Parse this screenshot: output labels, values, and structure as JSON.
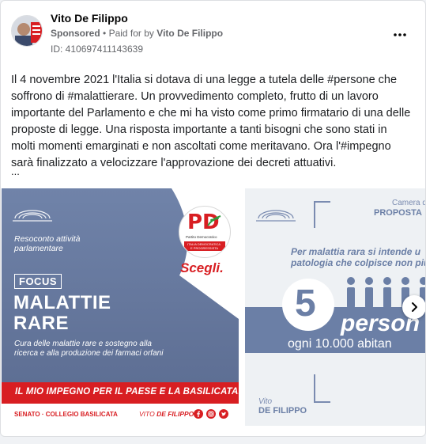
{
  "post": {
    "author": "Vito De Filippo",
    "sponsored": "Sponsored",
    "separator": "•",
    "paid_for_by": "Paid for by",
    "payer": "Vito De Filippo",
    "ad_id": "ID: 410697411143639",
    "body": "Il 4 novembre 2021 l'Italia si dotava di una legge a tutela delle #persone che soffrono di #malattierare. Un provvedimento completo, frutto di un lavoro importante del Parlamento e che mi ha visto come primo firmatario di una delle proposte di legge. Una risposta importante a tanti bisogni che sono stati in molti momenti emarginati e non ascoltati come meritavano. Ora l'#impegno sarà finalizzato a velocizzare l'approvazione dei decreti attuativi.",
    "ellipsis": "..."
  },
  "slide1": {
    "resoconto_line1": "Resoconto attività",
    "resoconto_line2": "parlamentare",
    "focus": "FOCUS",
    "title_line1": "MALATTIE",
    "title_line2": "RARE",
    "desc_line1": "Cura delle malattie rare e sostegno alla",
    "desc_line2": "ricerca e alla produzione dei farmaci orfani",
    "party_logo_text": "PD",
    "party_name": "Partito Democratico",
    "party_list_line1": "ITALIA DEMOCRATICA",
    "party_list_line2": "E PROGRESSISTA",
    "scegli": "Scegli.",
    "banner": "IL MIO IMPEGNO PER IL PAESE E LA BASILICATA.",
    "footer_left": "SENATO · COLLEGIO BASILICATA",
    "footer_name_first": "VITO",
    "footer_name_last": "DE FILIPPO",
    "colors": {
      "blue": "#6b7fa6",
      "red": "#d81e22",
      "green": "#2e9a3e"
    }
  },
  "slide2": {
    "camera": "Camera d",
    "proposta": "PROPOSTA",
    "line1": "Per malattia rara si intende u",
    "line2": "patologia che colpisce non più",
    "number": "5",
    "persone": "person",
    "ogni": "ogni 10.000 abitan",
    "vito": "Vito",
    "de_filippo": "DE FILIPPO"
  },
  "icons": {
    "more": "more-horizontal-icon",
    "next": "chevron-right-icon"
  }
}
